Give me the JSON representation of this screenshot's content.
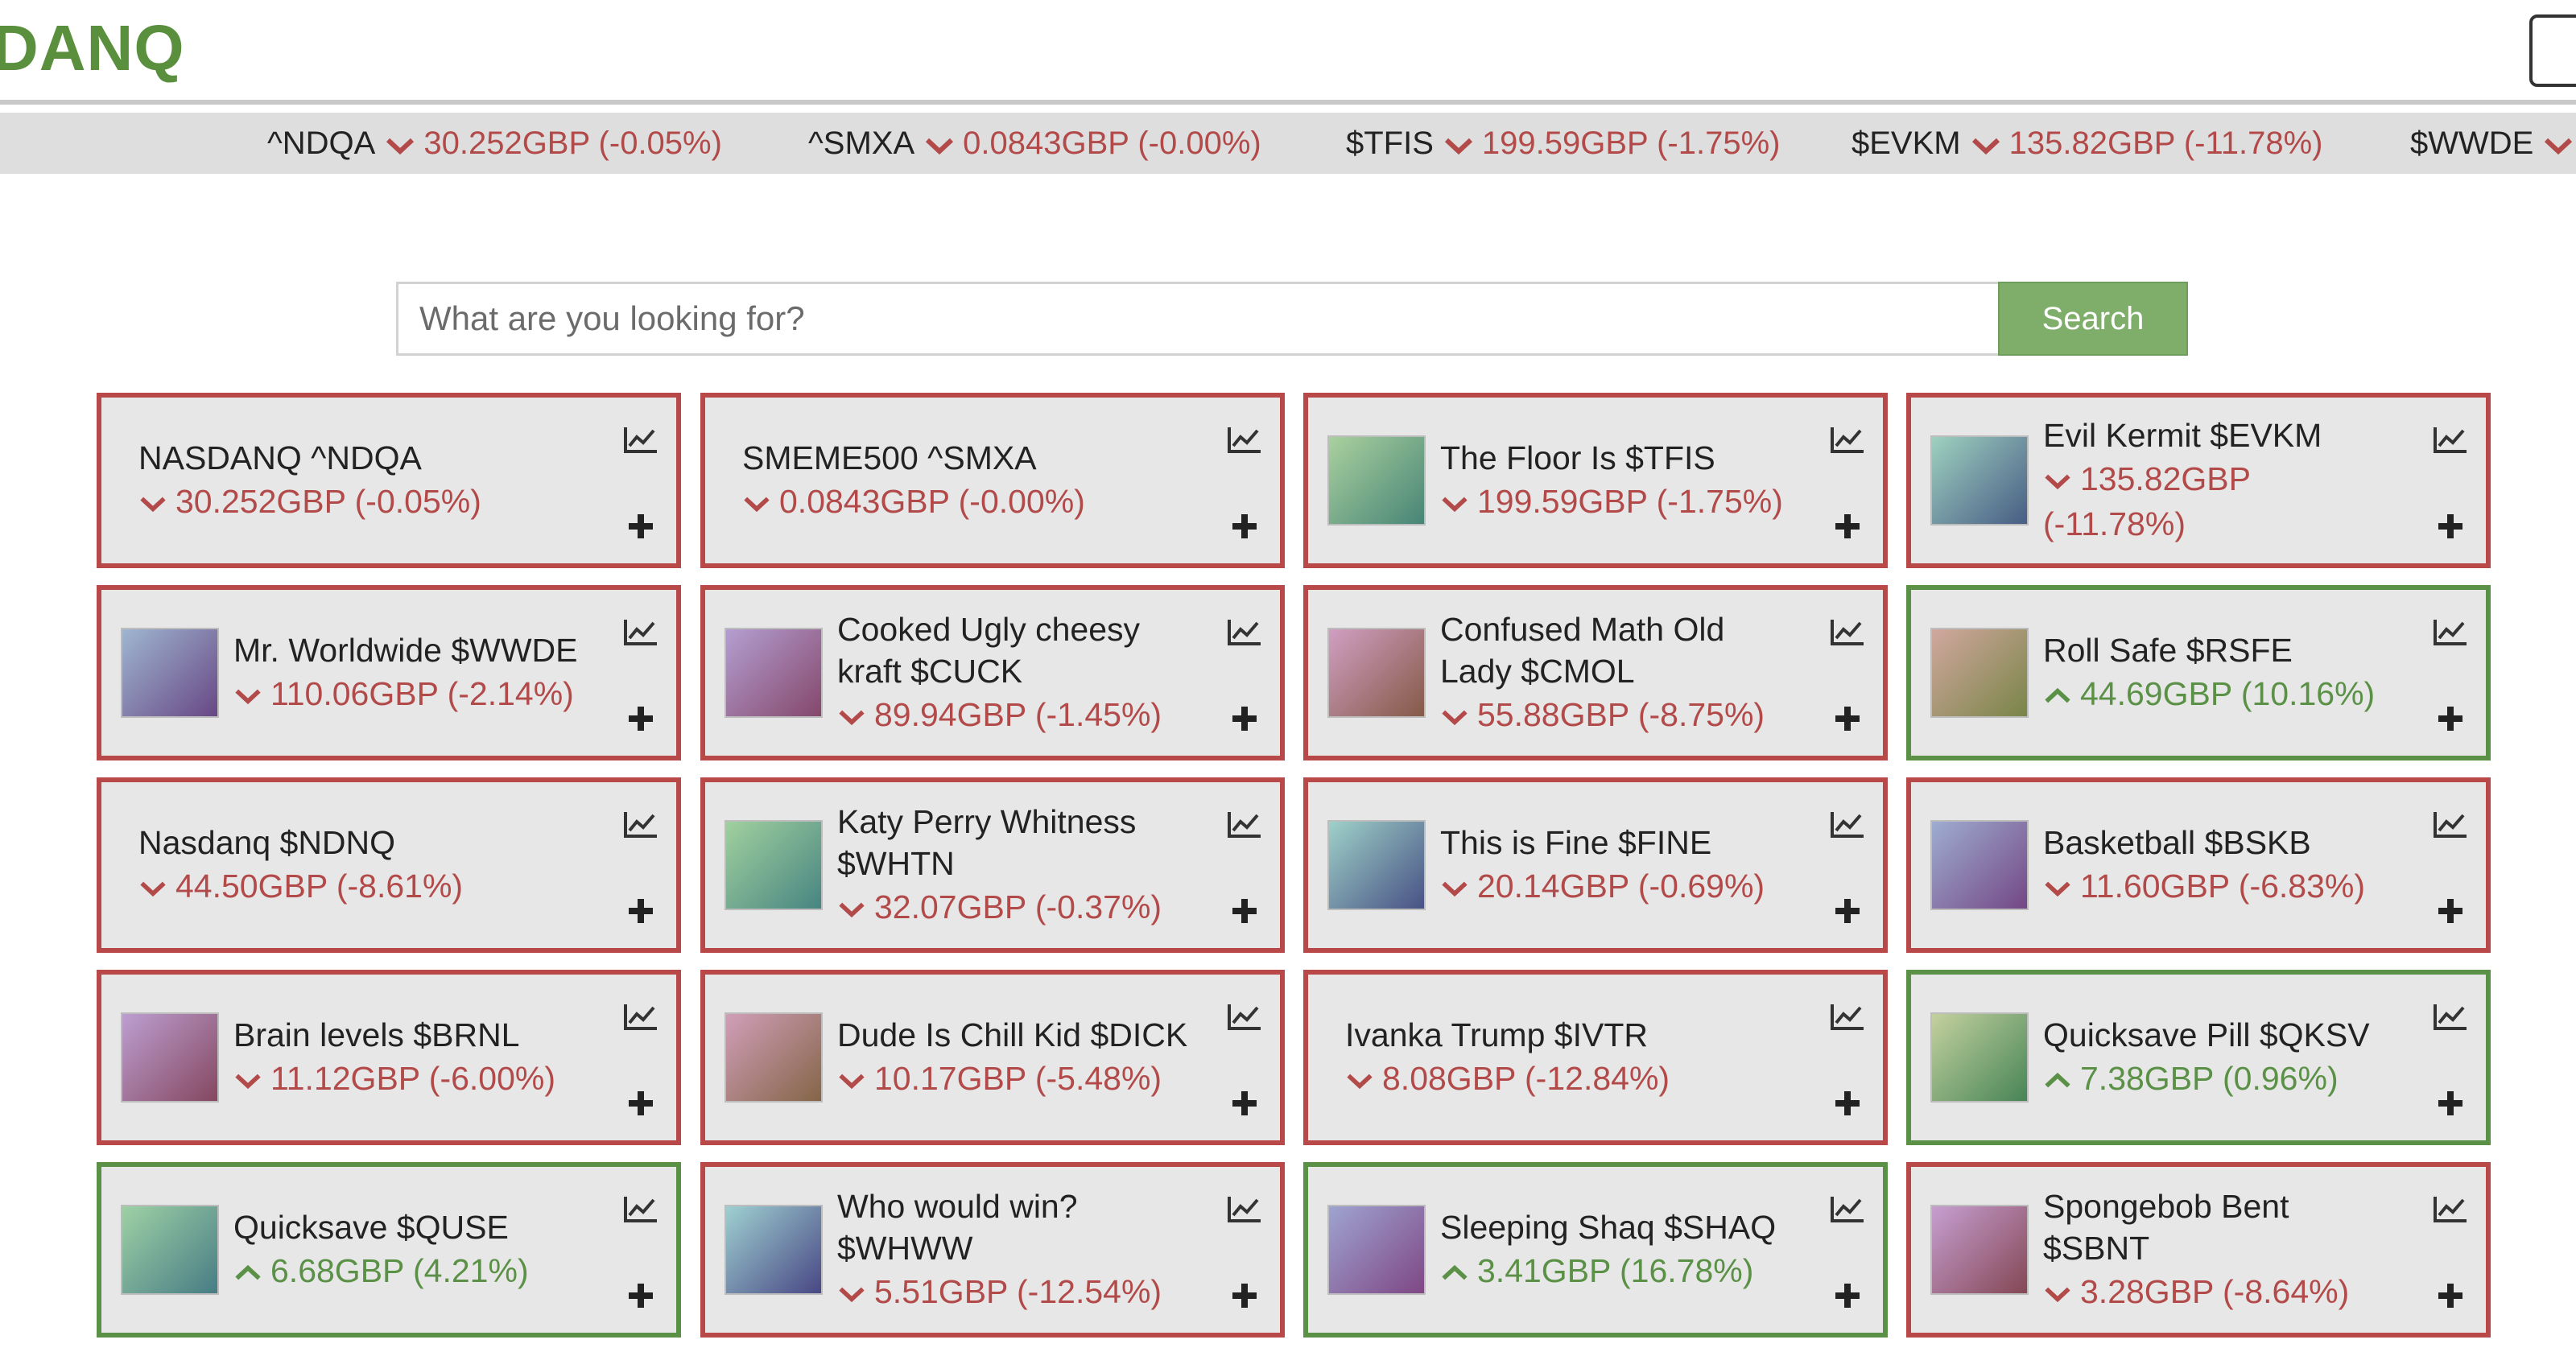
{
  "logo": "DANQ",
  "ticker": [
    {
      "symbol": "^NDQA",
      "value": "30.252GBP (-0.05%)",
      "dir": "down"
    },
    {
      "symbol": "^SMXA",
      "value": "0.0843GBP (-0.00%)",
      "dir": "down"
    },
    {
      "symbol": "$TFIS",
      "value": "199.59GBP (-1.75%)",
      "dir": "down"
    },
    {
      "symbol": "$EVKM",
      "value": "135.82GBP (-11.78%)",
      "dir": "down"
    },
    {
      "symbol": "$WWDE",
      "value": "",
      "dir": "down"
    }
  ],
  "search": {
    "placeholder": "What are you looking for?",
    "button": "Search"
  },
  "cards": [
    {
      "name": "NASDANQ ^NDQA",
      "price": "30.252GBP (-0.05%)",
      "dir": "down",
      "thumb": false
    },
    {
      "name": "SMEME500 ^SMXA",
      "price": "0.0843GBP (-0.00%)",
      "dir": "down",
      "thumb": false
    },
    {
      "name": "The Floor Is $TFIS",
      "price": "199.59GBP (-1.75%)",
      "dir": "down",
      "thumb": true
    },
    {
      "name": "Evil Kermit $EVKM",
      "price": "135.82GBP (-11.78%)",
      "dir": "down",
      "thumb": true
    },
    {
      "name": "Mr. Worldwide $WWDE",
      "price": "110.06GBP (-2.14%)",
      "dir": "down",
      "thumb": true
    },
    {
      "name": "Cooked Ugly cheesy kraft $CUCK",
      "price": "89.94GBP (-1.45%)",
      "dir": "down",
      "thumb": true
    },
    {
      "name": "Confused Math Old Lady $CMOL",
      "price": "55.88GBP (-8.75%)",
      "dir": "down",
      "thumb": true
    },
    {
      "name": "Roll Safe $RSFE",
      "price": "44.69GBP (10.16%)",
      "dir": "up",
      "thumb": true
    },
    {
      "name": "Nasdanq $NDNQ",
      "price": "44.50GBP (-8.61%)",
      "dir": "down",
      "thumb": false
    },
    {
      "name": "Katy Perry Whitness $WHTN",
      "price": "32.07GBP (-0.37%)",
      "dir": "down",
      "thumb": true
    },
    {
      "name": "This is Fine $FINE",
      "price": "20.14GBP (-0.69%)",
      "dir": "down",
      "thumb": true
    },
    {
      "name": "Basketball $BSKB",
      "price": "11.60GBP (-6.83%)",
      "dir": "down",
      "thumb": true
    },
    {
      "name": "Brain levels $BRNL",
      "price": "11.12GBP (-6.00%)",
      "dir": "down",
      "thumb": true
    },
    {
      "name": "Dude Is Chill Kid $DICK",
      "price": "10.17GBP (-5.48%)",
      "dir": "down",
      "thumb": true
    },
    {
      "name": "Ivanka Trump $IVTR",
      "price": "8.08GBP (-12.84%)",
      "dir": "down",
      "thumb": false
    },
    {
      "name": "Quicksave Pill $QKSV",
      "price": "7.38GBP (0.96%)",
      "dir": "up",
      "thumb": true
    },
    {
      "name": "Quicksave $QUSE",
      "price": "6.68GBP (4.21%)",
      "dir": "up",
      "thumb": true
    },
    {
      "name": "Who would win? $WHWW",
      "price": "5.51GBP (-12.54%)",
      "dir": "down",
      "thumb": true
    },
    {
      "name": "Sleeping Shaq $SHAQ",
      "price": "3.41GBP (16.78%)",
      "dir": "up",
      "thumb": true
    },
    {
      "name": "Spongebob Bent $SBNT",
      "price": "3.28GBP (-8.64%)",
      "dir": "down",
      "thumb": true
    }
  ],
  "colors": {
    "down": "#b34a4a",
    "up": "#5b9146",
    "brand": "#5a8f3e",
    "search_button": "#7fae6b",
    "down_border": "#b94848",
    "up_border": "#5b9146"
  }
}
